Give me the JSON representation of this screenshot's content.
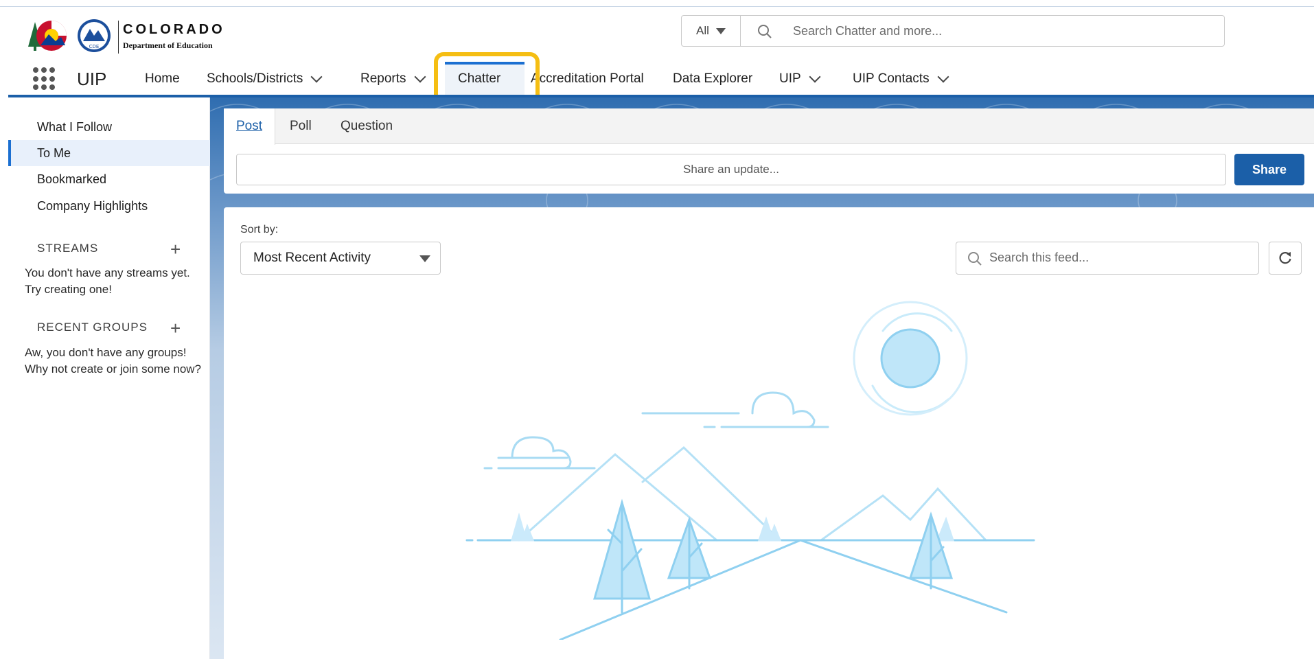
{
  "header": {
    "logo": {
      "title": "COLORADO",
      "subtitle": "Department of Education",
      "badge": "CDE"
    },
    "search": {
      "scope": "All",
      "placeholder": "Search Chatter and more..."
    }
  },
  "nav": {
    "app_name": "UIP",
    "items": [
      {
        "label": "Home"
      },
      {
        "label": "Schools/Districts"
      },
      {
        "label": "Reports"
      },
      {
        "label": "Chatter"
      },
      {
        "label": "Accreditation Portal"
      },
      {
        "label": "Data Explorer"
      },
      {
        "label": "UIP"
      },
      {
        "label": "UIP Contacts"
      }
    ],
    "active": "Chatter",
    "highlight_color": "#f5be13",
    "accent_color": "#1b6fd1"
  },
  "sidebar": {
    "items": [
      {
        "label": "What I Follow"
      },
      {
        "label": "To Me"
      },
      {
        "label": "Bookmarked"
      },
      {
        "label": "Company Highlights"
      }
    ],
    "active": "To Me",
    "streams": {
      "heading": "STREAMS",
      "empty_text": "You don't have any streams yet. Try creating one!"
    },
    "groups": {
      "heading": "RECENT GROUPS",
      "empty_text": "Aw, you don't have any groups! Why not create or join some now?"
    }
  },
  "publisher": {
    "tabs": [
      {
        "label": "Post"
      },
      {
        "label": "Poll"
      },
      {
        "label": "Question"
      }
    ],
    "active_tab": "Post",
    "input_placeholder": "Share an update...",
    "share_label": "Share",
    "brand_color": "#1b5fa8"
  },
  "feed": {
    "sort_label": "Sort by:",
    "sort_value": "Most Recent Activity",
    "search_placeholder": "Search this feed..."
  }
}
